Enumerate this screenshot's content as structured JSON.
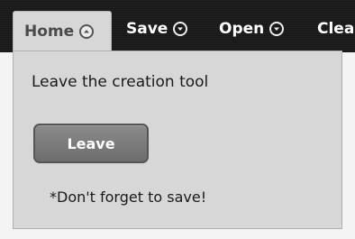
{
  "menubar": {
    "tabs": [
      {
        "label": "Home",
        "icon": "chevron-up-circle-icon",
        "active": true
      },
      {
        "label": "Save",
        "icon": "chevron-down-circle-icon",
        "active": false
      },
      {
        "label": "Open",
        "icon": "chevron-down-circle-icon",
        "active": false
      },
      {
        "label": "Clea",
        "icon": "",
        "active": false
      }
    ]
  },
  "dropdown": {
    "heading": "Leave the creation tool",
    "button_label": "Leave",
    "note": "*Don't forget to save!"
  },
  "colors": {
    "menubar_bg": "#1a1a1a",
    "panel_bg": "#d7d7d7",
    "button_bg": "#7a7a7a"
  }
}
